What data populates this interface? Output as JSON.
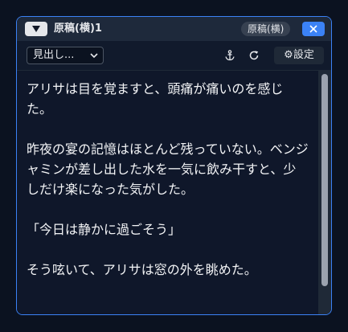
{
  "panel": {
    "title": "原稿(横)1",
    "badge": "原稿(横)",
    "collapse_icon": "triangle-down-icon",
    "close_icon": "close-icon",
    "colors": {
      "border": "#3b82f6",
      "close_bg": "#3b82f6",
      "background": "#0f172a"
    }
  },
  "toolbar": {
    "select_value": "見出し...",
    "anchor_icon": "anchor-icon",
    "refresh_icon": "refresh-icon",
    "settings_label": "⚙設定"
  },
  "content": {
    "paragraphs": [
      "アリサは目を覚ますと、頭痛が痛いのを感じた。",
      "昨夜の宴の記憶はほとんど残っていない。ベンジャミンが差し出した水を一気に飲み干すと、少しだけ楽になった気がした。",
      "「今日は静かに過ごそう」",
      "そう呟いて、アリサは窓の外を眺めた。"
    ]
  }
}
